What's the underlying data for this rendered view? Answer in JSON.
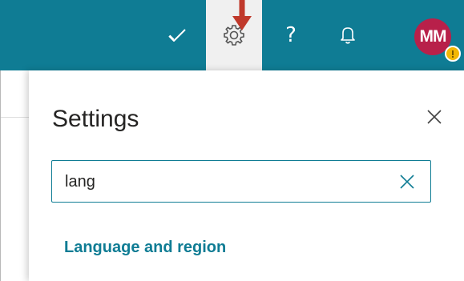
{
  "header": {
    "accent_color": "#0f7c94",
    "icons": [
      {
        "name": "todo-check-icon"
      },
      {
        "name": "settings-gear-icon",
        "active": true
      },
      {
        "name": "help-icon",
        "glyph": "?"
      },
      {
        "name": "bell-icon"
      }
    ],
    "help_glyph": "?",
    "avatar": {
      "initials": "MM",
      "color": "#b8204a",
      "badge_color": "#f2b705"
    }
  },
  "settings_panel": {
    "title": "Settings",
    "search": {
      "value": "lang",
      "placeholder": ""
    },
    "results": [
      {
        "label": "Language and region"
      }
    ]
  }
}
